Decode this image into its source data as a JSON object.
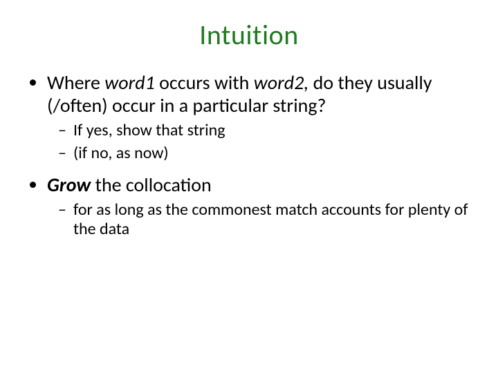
{
  "title": "Intuition",
  "b1_pre": "Where ",
  "b1_w1": "word1",
  "b1_mid": " occurs with ",
  "b1_w2": "word2,",
  "b1_post": " do they usually (/often) occur in a particular string?",
  "b1_sub1": "If yes, show that string",
  "b1_sub2": "(if no, as now)",
  "b2_grow": "Grow ",
  "b2_rest": " the collocation",
  "b2_sub1": "for as long as the commonest match accounts for plenty of the data"
}
